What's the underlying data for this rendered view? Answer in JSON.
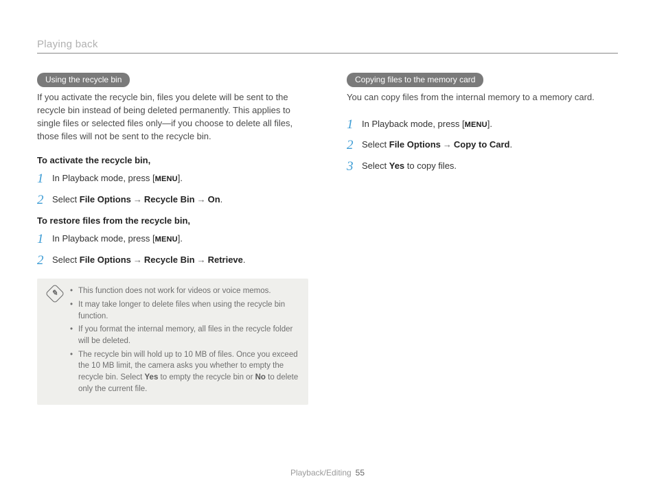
{
  "header": {
    "title": "Playing back"
  },
  "left": {
    "pill": "Using the recycle bin",
    "intro": "If you activate the recycle bin, files you delete will be sent to the recycle bin instead of being deleted permanently. This applies to single files or selected files only—if you choose to delete all files, those files will not be sent to the recycle bin.",
    "sub1": "To activate the recycle bin,",
    "steps1": {
      "s1_pre": "In Playback mode, press [",
      "s1_menu": "MENU",
      "s1_post": "].",
      "s2_pre": "Select ",
      "s2_a": "File Options",
      "s2_b": "Recycle Bin",
      "s2_c": "On",
      "s2_post": "."
    },
    "sub2": "To restore files from the recycle bin,",
    "steps2": {
      "s1_pre": "In Playback mode, press [",
      "s1_menu": "MENU",
      "s1_post": "].",
      "s2_pre": "Select ",
      "s2_a": "File Options",
      "s2_b": "Recycle Bin",
      "s2_c": "Retrieve",
      "s2_post": "."
    },
    "notes": {
      "n1": "This function does not work for videos or voice memos.",
      "n2": "It may take longer to delete files when using the recycle bin function.",
      "n3": "If you format the internal memory, all files in the recycle folder will be deleted.",
      "n4_a": "The recycle bin will hold up to 10 MB of files. Once you exceed the 10 MB limit, the camera asks you whether to empty the recycle bin. Select ",
      "n4_yes": "Yes",
      "n4_b": " to empty the recycle bin or ",
      "n4_no": "No",
      "n4_c": " to delete only the current file."
    }
  },
  "right": {
    "pill": "Copying files to the memory card",
    "intro": "You can copy files from the internal memory to a memory card.",
    "steps": {
      "s1_pre": "In Playback mode, press [",
      "s1_menu": "MENU",
      "s1_post": "].",
      "s2_pre": "Select ",
      "s2_a": "File Options",
      "s2_b": "Copy to Card",
      "s2_post": ".",
      "s3_pre": "Select ",
      "s3_a": "Yes",
      "s3_post": " to copy files."
    }
  },
  "numbers": {
    "n1": "1",
    "n2": "2",
    "n3": "3"
  },
  "arrow": "→",
  "footer": {
    "section": "Playback/Editing",
    "page": "55"
  }
}
